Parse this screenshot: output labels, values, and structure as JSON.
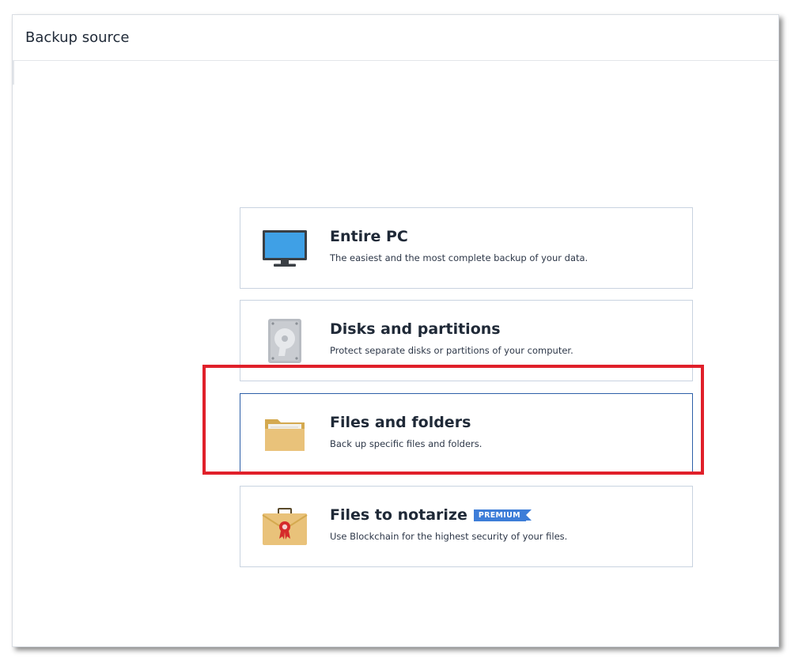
{
  "header": {
    "title": "Backup source"
  },
  "options": [
    {
      "id": "entire-pc",
      "title": "Entire PC",
      "description": "The easiest and the most complete backup of your data.",
      "icon": "monitor-icon"
    },
    {
      "id": "disks-partitions",
      "title": "Disks and partitions",
      "description": "Protect separate disks or partitions of your computer.",
      "icon": "hard-disk-icon"
    },
    {
      "id": "files-folders",
      "title": "Files and folders",
      "description": "Back up specific files and folders.",
      "icon": "folder-icon",
      "selected": true
    },
    {
      "id": "files-notarize",
      "title": "Files to notarize",
      "description": "Use Blockchain for the highest security of your files.",
      "icon": "notarize-briefcase-icon",
      "badge": "PREMIUM"
    }
  ],
  "colors": {
    "selected_border": "#2d5fa8",
    "card_border": "#c9d3e0",
    "highlight": "#e0202a",
    "badge": "#3d7dd8"
  }
}
